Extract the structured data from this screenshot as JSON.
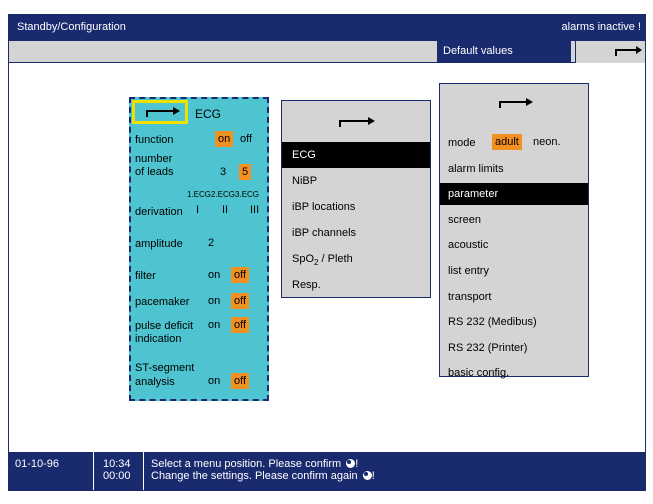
{
  "titlebar": {
    "title": "Standby/Configuration",
    "alarm_status": "alarms inactive !"
  },
  "subbar": {
    "defaults_label": "Default values",
    "arrow_icon": "return-arrow-icon"
  },
  "ecg_panel": {
    "header": "ECG",
    "function_label": "function",
    "function_on": "on",
    "function_off": "off",
    "function_selected": "on",
    "leads_label_1": "number",
    "leads_label_2": "of leads",
    "leads_3": "3",
    "leads_5": "5",
    "leads_selected": "5",
    "ecg_channels": "1.ECG2.ECG3.ECG",
    "derivation_label": "derivation",
    "deriv_1": "I",
    "deriv_2": "II",
    "deriv_3": "III",
    "amplitude_label": "amplitude",
    "amplitude_value": "2",
    "filter_label": "filter",
    "filter_on": "on",
    "filter_off": "off",
    "filter_selected": "off",
    "pacemaker_label": "pacemaker",
    "pacemaker_on": "on",
    "pacemaker_off": "off",
    "pacemaker_selected": "off",
    "pulse_label_1": "pulse deficit",
    "pulse_label_2": "indication",
    "pulse_on": "on",
    "pulse_off": "off",
    "pulse_selected": "off",
    "st_label_1": "ST-segment",
    "st_label_2": "analysis",
    "st_on": "on",
    "st_off": "off",
    "st_selected": "off"
  },
  "menu": {
    "items": [
      "ECG",
      "NiBP",
      "iBP locations",
      "iBP channels",
      "SpO2 / Pleth",
      "Resp."
    ],
    "spo2_main": "SpO",
    "spo2_sub": "2",
    "spo2_rest": " / Pleth",
    "active": "ECG"
  },
  "config": {
    "mode_label": "mode",
    "mode_adult": "adult",
    "mode_neon": "neon.",
    "mode_selected": "adult",
    "items": [
      "alarm limits",
      "parameter",
      "screen",
      "acoustic",
      "list entry",
      "transport",
      "RS 232 (Medibus)",
      "RS 232 (Printer)",
      "basic config."
    ],
    "active": "parameter"
  },
  "status": {
    "date": "01-10-96",
    "time": "10:34",
    "elapsed": "00:00",
    "msg1": "Select a menu position. Please confirm",
    "msg2": "Change the settings. Please confirm again",
    "msg_suffix": "!"
  },
  "colors": {
    "navy": "#1a2a6e",
    "teal": "#4dc4cf",
    "orange": "#f39021",
    "yellow": "#f0e000",
    "grey": "#d4d4d4"
  }
}
